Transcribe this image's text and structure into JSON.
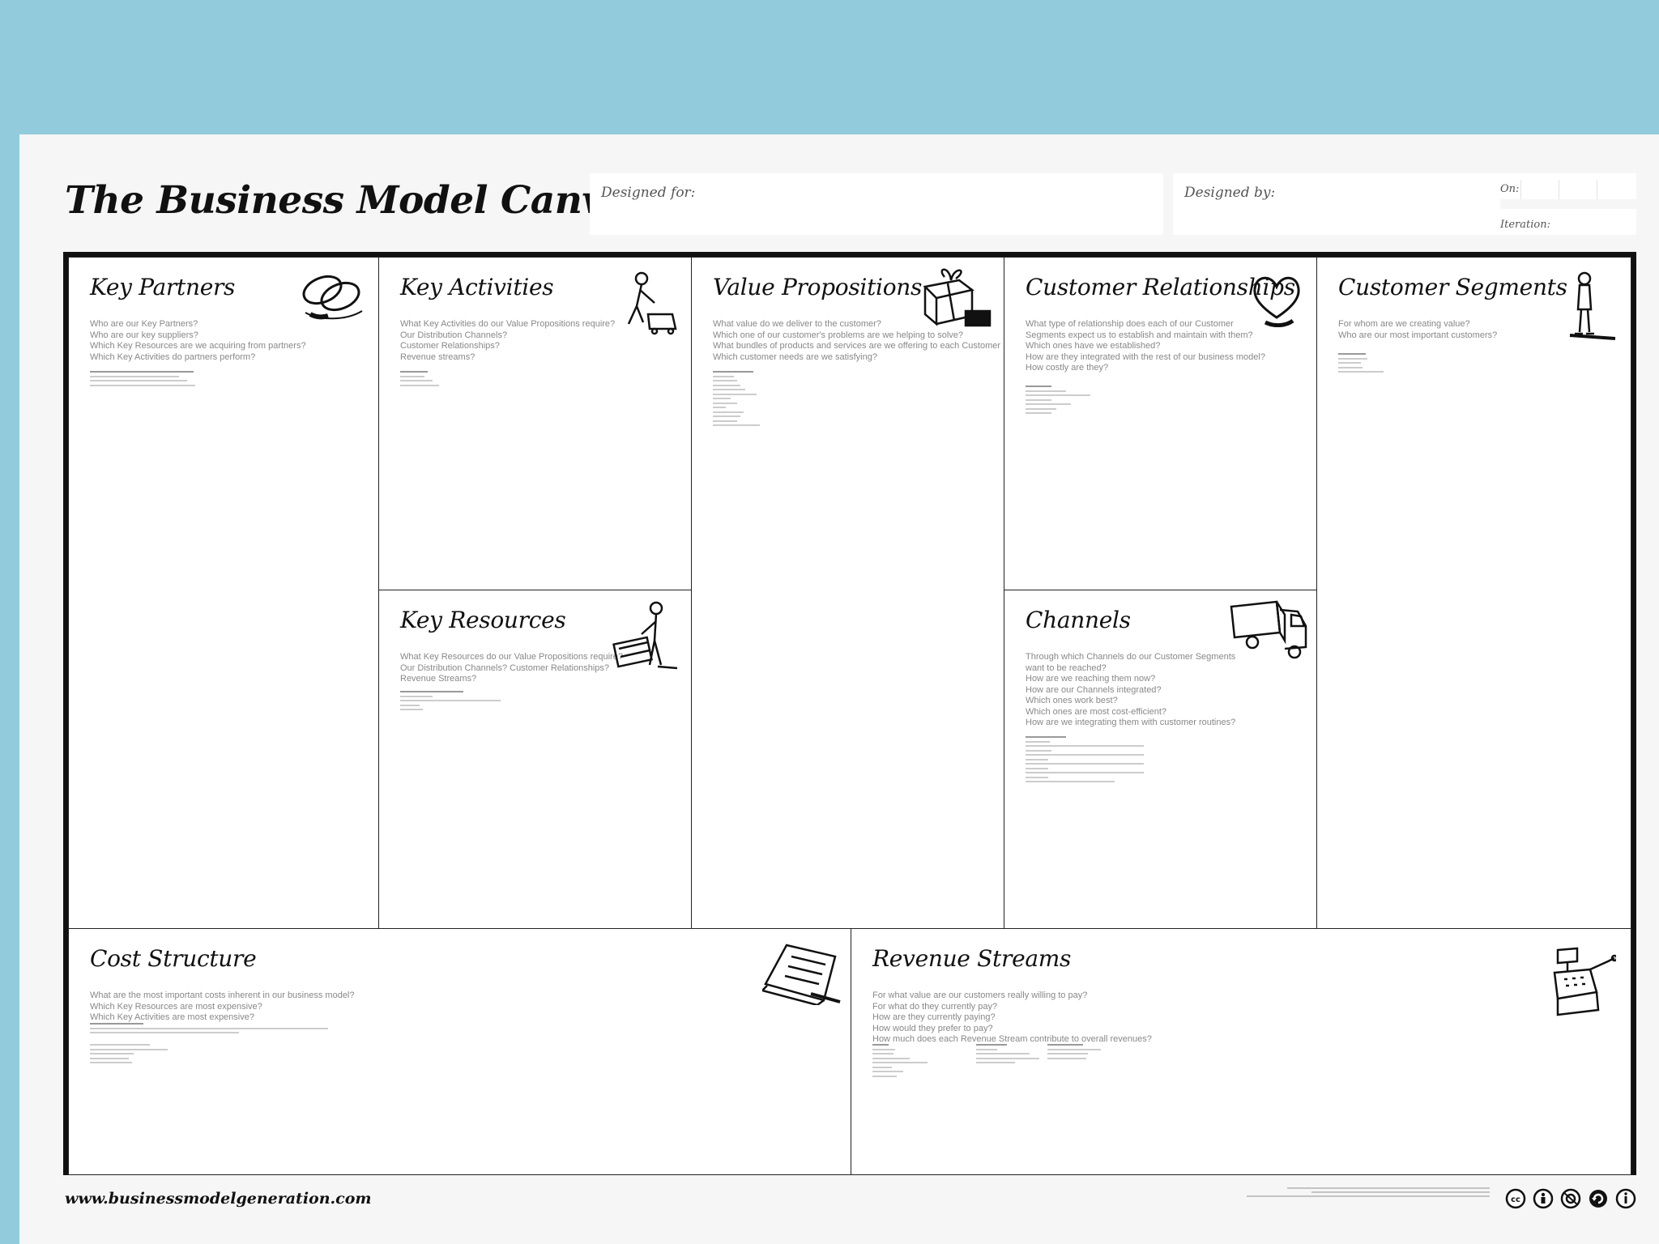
{
  "title": "The Business Model Canvas",
  "header": {
    "designed_for": "Designed for:",
    "designed_by": "Designed by:",
    "on": "On:",
    "iteration": "Iteration:"
  },
  "blocks": {
    "key_partners": {
      "title": "Key Partners",
      "questions": [
        "Who are our Key Partners?",
        "Who are our key suppliers?",
        "Which Key Resources are we acquiring from partners?",
        "Which Key Activities do partners perform?"
      ]
    },
    "key_activities": {
      "title": "Key Activities",
      "questions": [
        "What Key Activities do our Value Propositions require?",
        "Our Distribution Channels?",
        "Customer Relationships?",
        "Revenue streams?"
      ]
    },
    "key_resources": {
      "title": "Key Resources",
      "questions": [
        "What Key Resources do our Value Propositions require?",
        "Our Distribution Channels? Customer Relationships?",
        "Revenue Streams?"
      ]
    },
    "value_propositions": {
      "title": "Value Propositions",
      "questions": [
        "What value do we deliver to the customer?",
        "Which one of our customer's problems are we helping to solve?",
        "What bundles of products and services are we offering to each Customer Segment?",
        "Which customer needs are we satisfying?"
      ]
    },
    "customer_relationships": {
      "title": "Customer Relationships",
      "questions": [
        "What type of relationship does each of our Customer",
        "Segments expect us to establish and maintain with them?",
        "Which ones have we established?",
        "How are they integrated with the rest of our business model?",
        "How costly are they?"
      ]
    },
    "channels": {
      "title": "Channels",
      "questions": [
        "Through which Channels do our Customer Segments",
        "want to be reached?",
        "How are we reaching them now?",
        "How are our Channels integrated?",
        "Which ones work best?",
        "Which ones are most cost-efficient?",
        "How are we integrating them with customer routines?"
      ]
    },
    "customer_segments": {
      "title": "Customer Segments",
      "questions": [
        "For whom are we creating value?",
        "Who are our most important customers?"
      ]
    },
    "cost_structure": {
      "title": "Cost Structure",
      "questions": [
        "What are the most important costs inherent in our business model?",
        "Which Key Resources are most expensive?",
        "Which Key Activities are most expensive?"
      ]
    },
    "revenue_streams": {
      "title": "Revenue Streams",
      "questions": [
        "For what value are our customers really willing to pay?",
        "For what do they currently pay?",
        "How are they currently paying?",
        "How would they prefer to pay?",
        "How much does each Revenue Stream contribute to overall revenues?"
      ]
    }
  },
  "icons": {
    "key_partners": "chain-link-icon",
    "key_activities": "worker-pushing-cart-icon",
    "key_resources": "worker-with-crate-icon",
    "value_propositions": "gift-box-icon",
    "customer_relationships": "heart-icon",
    "channels": "delivery-truck-icon",
    "customer_segments": "standing-person-icon",
    "cost_structure": "price-tag-icon",
    "revenue_streams": "cash-register-icon"
  },
  "footer": {
    "url": "www.businessmodelgeneration.com",
    "license_icons": [
      "cc-icon",
      "by-icon",
      "nc-icon",
      "sa-icon",
      "info-icon"
    ]
  }
}
